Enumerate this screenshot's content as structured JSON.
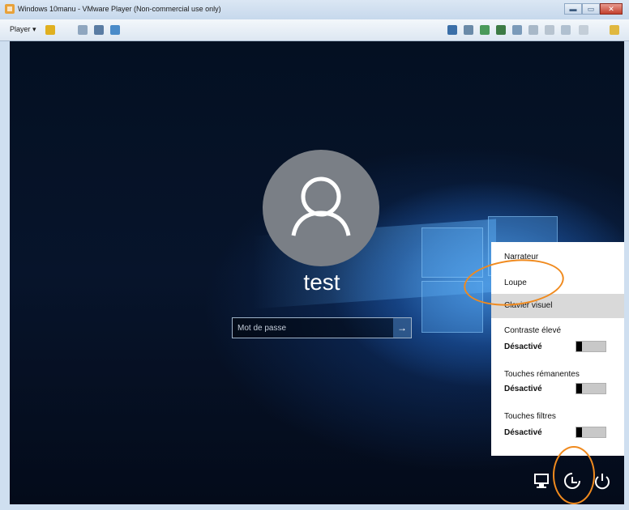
{
  "window": {
    "title": "Windows 10manu - VMware Player (Non-commercial use only)",
    "player_menu": "Player ▾",
    "controls": {
      "minimize": "▬",
      "maximize": "▭",
      "close": "✕"
    }
  },
  "login": {
    "username": "test",
    "password_placeholder": "Mot de passe",
    "submit_glyph": "→"
  },
  "accessibility_menu": {
    "items": [
      {
        "label": "Narrateur"
      },
      {
        "label": "Loupe"
      },
      {
        "label": "Clavier visuel",
        "highlighted": true
      }
    ],
    "toggles": [
      {
        "label": "Contraste élevé",
        "state": "Désactivé"
      },
      {
        "label": "Touches rémanentes",
        "state": "Désactivé"
      },
      {
        "label": "Touches filtres",
        "state": "Désactivé"
      }
    ]
  },
  "system_icons": [
    "network-icon",
    "ease-of-access-icon",
    "power-icon"
  ],
  "colors": {
    "annotation": "#f08a1e",
    "flyout_highlight": "#d9d9d9"
  }
}
